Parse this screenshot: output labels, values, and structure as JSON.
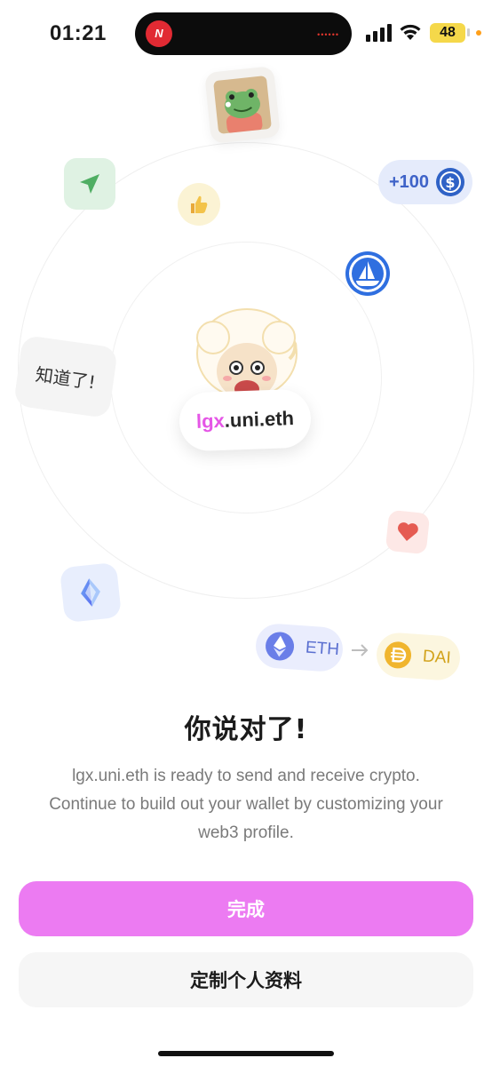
{
  "status_bar": {
    "time": "01:21",
    "app_badge": "N",
    "battery_level": "48",
    "colors": {
      "battery": "#f5d84a",
      "recording": "#e2362d"
    }
  },
  "hero": {
    "sticker_text": "知道了!",
    "usdc_amount": "+100",
    "username_accent": "lgx",
    "username_rest": ".uni.eth",
    "swap": {
      "from": "ETH",
      "to": "DAI"
    },
    "icons": [
      "frog-sticker-icon",
      "send-icon",
      "thumbs-up-icon",
      "usdc-icon",
      "opensea-icon",
      "mascot-icon",
      "heart-icon",
      "ens-icon",
      "eth-icon",
      "dai-icon",
      "arrow-right-icon"
    ]
  },
  "content": {
    "headline": "你说对了!",
    "description": "lgx.uni.eth is ready to send and receive crypto. Continue to build out your wallet by customizing your web3 profile."
  },
  "actions": {
    "done_label": "完成",
    "customize_label": "定制个人资料"
  },
  "colors": {
    "accent": "#ec7bf2",
    "username_accent": "#e556e6",
    "secondary_button": "#f6f6f6"
  }
}
